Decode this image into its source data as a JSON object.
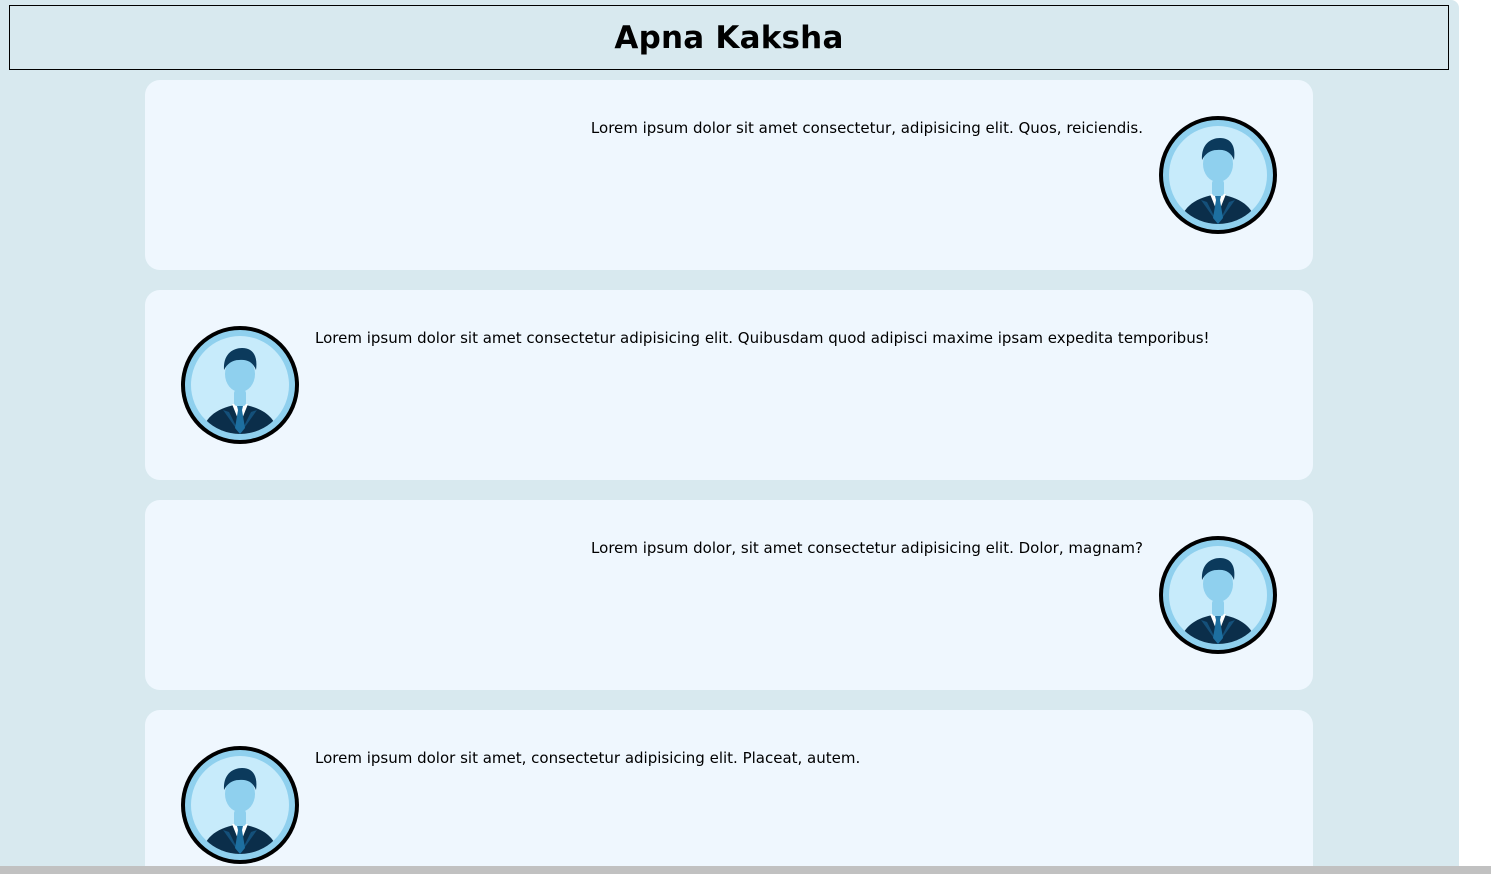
{
  "header": {
    "title": "Apna Kaksha"
  },
  "messages": [
    {
      "text": "Lorem ipsum dolor sit amet consectetur, adipisicing elit. Quos, reiciendis.",
      "align": "right",
      "avatar_icon": "user-avatar-icon"
    },
    {
      "text": "Lorem ipsum dolor sit amet consectetur adipisicing elit. Quibusdam quod adipisci maxime ipsam expedita temporibus!",
      "align": "left",
      "avatar_icon": "user-avatar-icon"
    },
    {
      "text": "Lorem ipsum dolor, sit amet consectetur adipisicing elit. Dolor, magnam?",
      "align": "right",
      "avatar_icon": "user-avatar-icon"
    },
    {
      "text": "Lorem ipsum dolor sit amet, consectetur adipisicing elit. Placeat, autem.",
      "align": "left",
      "avatar_icon": "user-avatar-icon"
    }
  ],
  "colors": {
    "page_background": "#d8e9ef",
    "card_background": "#eff7fe",
    "avatar_ring": "#000000",
    "avatar_fill": "#c7ebfb",
    "suit": "#0b2e4a"
  }
}
